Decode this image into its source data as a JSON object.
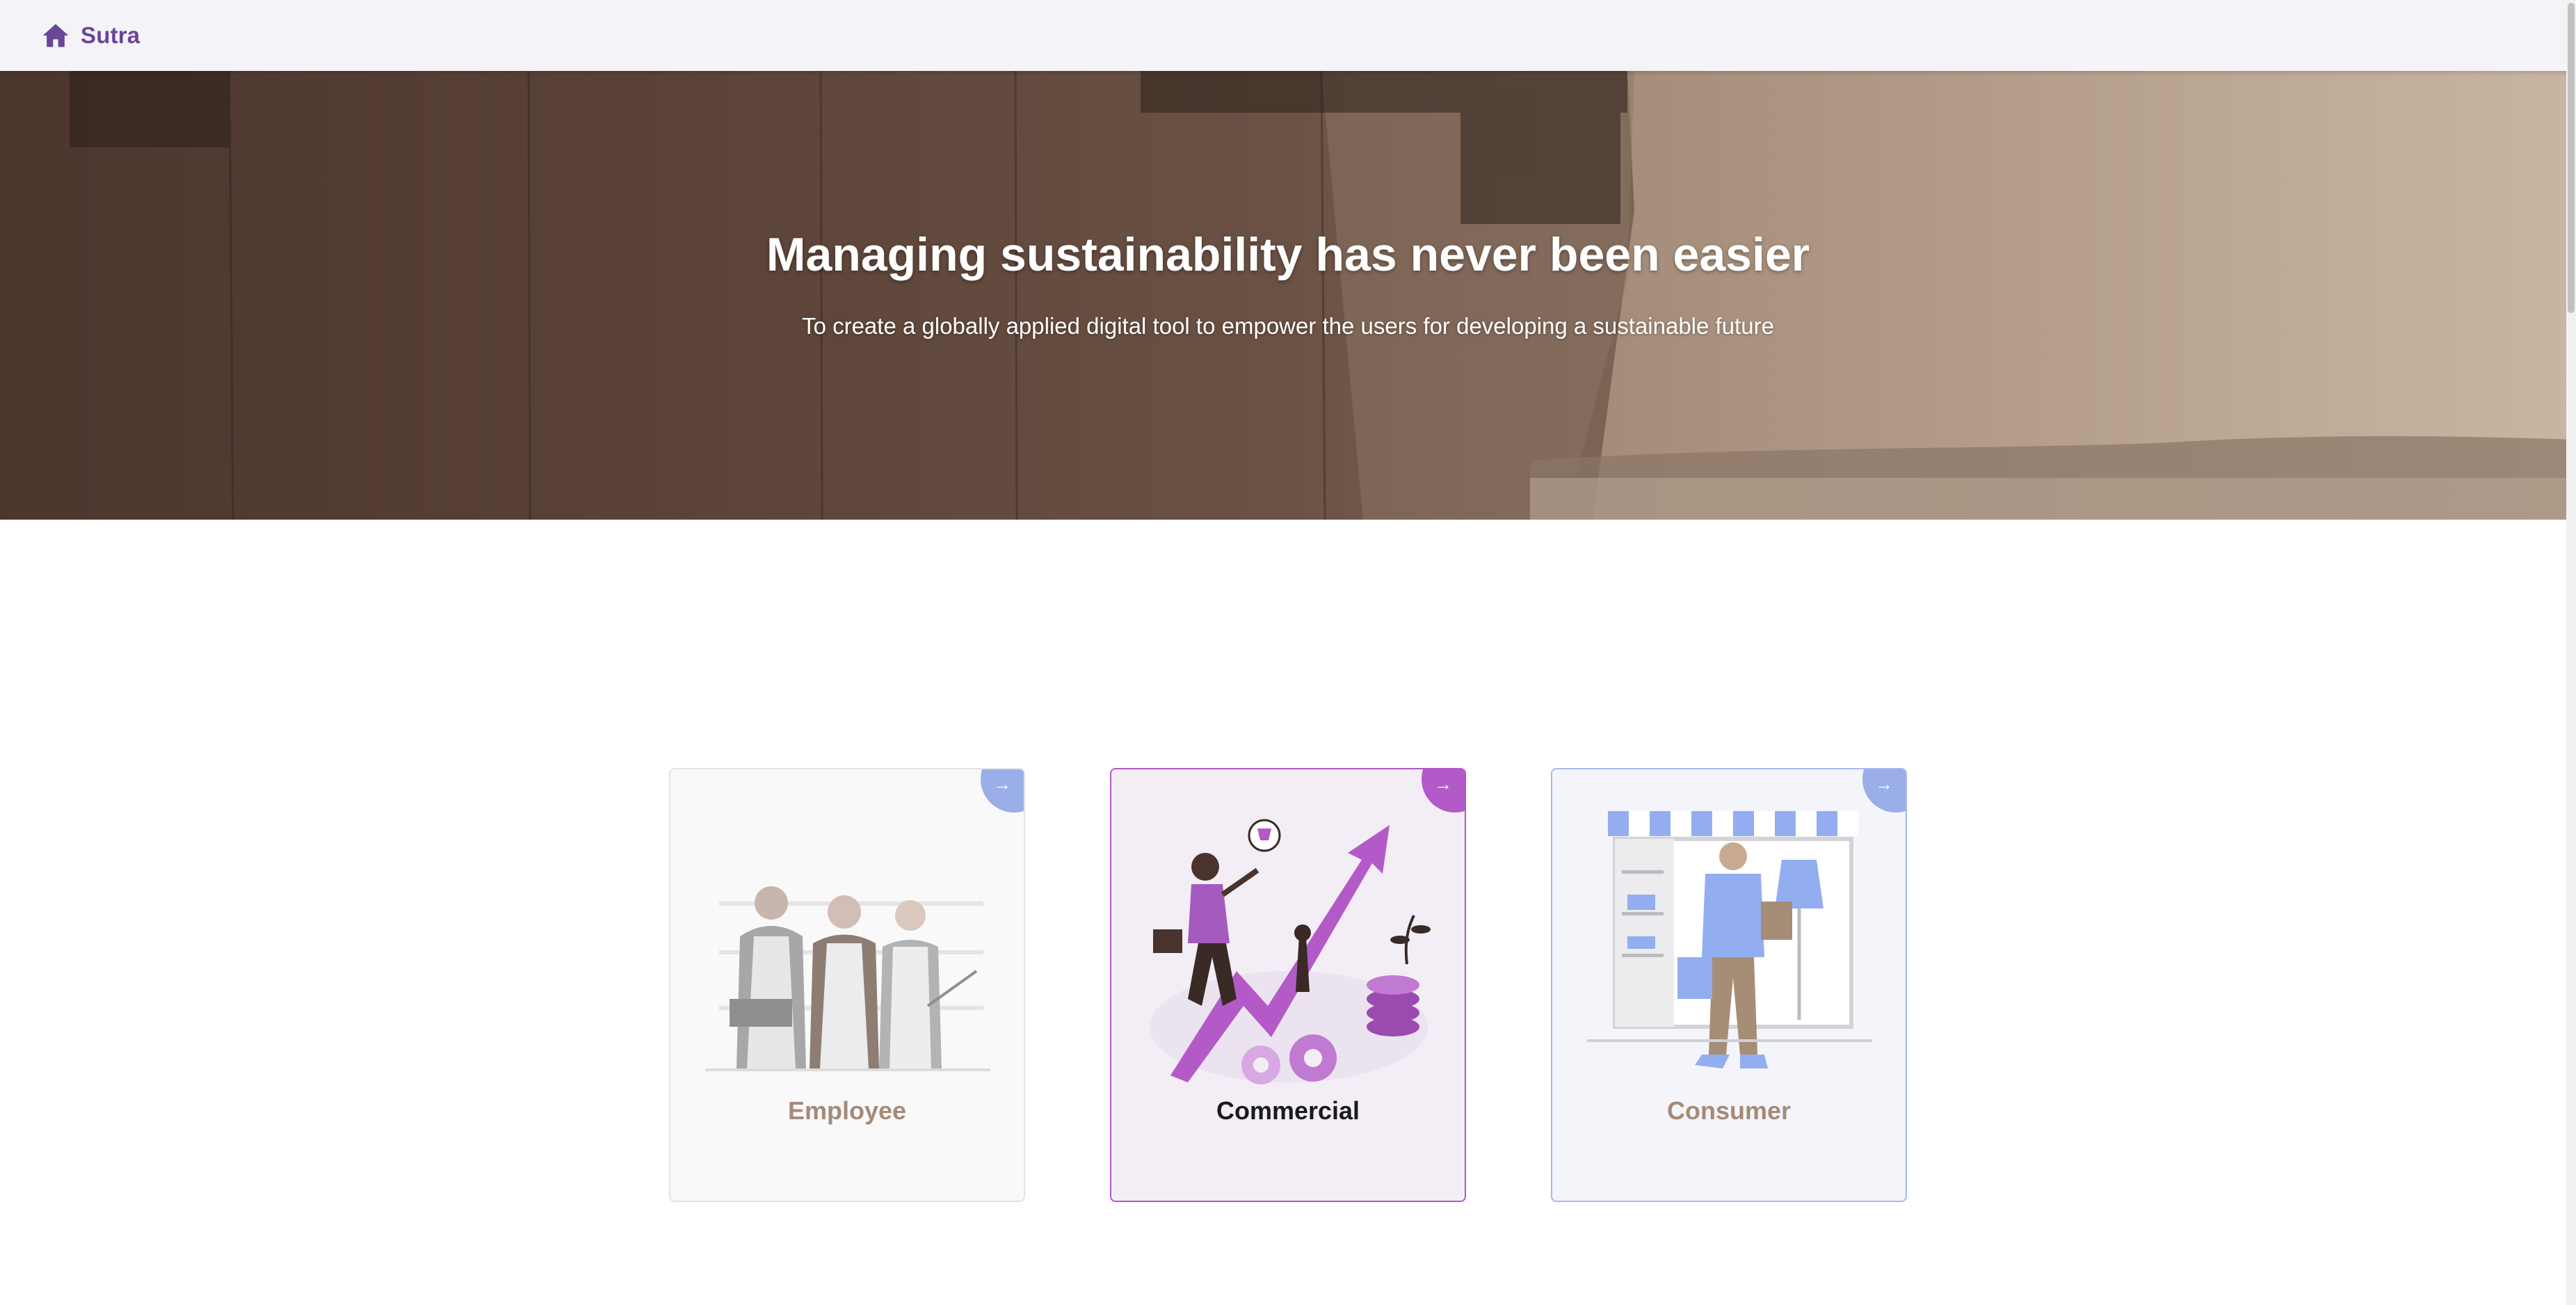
{
  "navbar": {
    "brand_name": "Sutra",
    "brand_icon": "home-icon",
    "brand_color": "#6b4597"
  },
  "hero": {
    "title": "Managing sustainability has never been easier",
    "subtitle": "To create a globally applied digital tool to empower the users for developing a sustainable future"
  },
  "cards": [
    {
      "label": "Employee",
      "arrow": "→",
      "accent": "#9aaee8",
      "selected": false
    },
    {
      "label": "Commercial",
      "arrow": "→",
      "accent": "#b35ac8",
      "selected": true
    },
    {
      "label": "Consumer",
      "arrow": "→",
      "accent": "#9aaee8",
      "selected": false
    }
  ]
}
